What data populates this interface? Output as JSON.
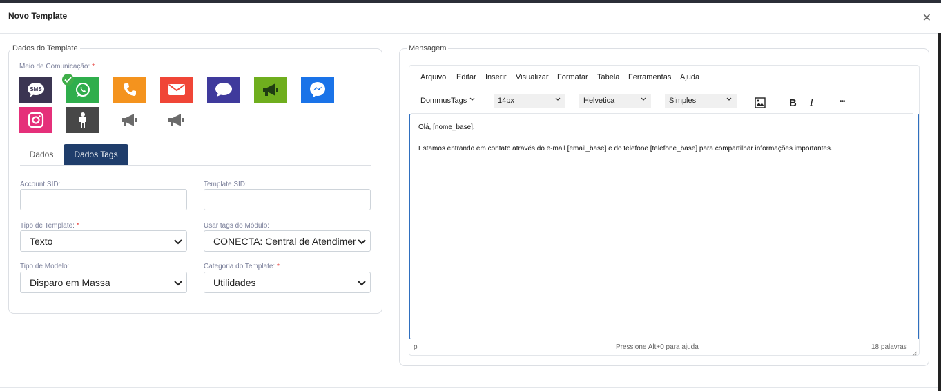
{
  "modal": {
    "title": "Novo Template"
  },
  "dados_template": {
    "legend": "Dados do Template",
    "meio_label": "Meio de Comunicação:",
    "channels": [
      {
        "name": "sms",
        "label": "SMS",
        "color": "#3b3552",
        "selected": false
      },
      {
        "name": "whatsapp",
        "color": "#2fae4c",
        "selected": true
      },
      {
        "name": "phone",
        "color": "#f4931e",
        "selected": false
      },
      {
        "name": "email",
        "color": "#f04637",
        "selected": false
      },
      {
        "name": "chat",
        "color": "#3f3a9c",
        "selected": false
      },
      {
        "name": "megaphone",
        "color": "#6fae1e",
        "selected": false
      },
      {
        "name": "messenger",
        "color": "#1a73e8",
        "selected": false
      },
      {
        "name": "instagram",
        "color": "#e5307a",
        "selected": false
      },
      {
        "name": "person",
        "color": "#474747",
        "selected": false
      },
      {
        "name": "megaphone-gray",
        "color": "#6b6b6b",
        "selected": false
      },
      {
        "name": "megaphone-gray-2",
        "color": "#6b6b6b",
        "selected": false
      }
    ],
    "tabs": {
      "dados": "Dados",
      "dados_tags": "Dados Tags"
    },
    "fields": {
      "account_sid_label": "Account SID:",
      "template_sid_label": "Template SID:",
      "tipo_template_label": "Tipo de Template:",
      "tipo_template_value": "Texto",
      "usar_tags_label": "Usar tags do Módulo:",
      "usar_tags_value": "CONECTA: Central de Atendimento",
      "tipo_modelo_label": "Tipo de Modelo:",
      "tipo_modelo_value": "Disparo em Massa",
      "categoria_label": "Categoria do Template:",
      "categoria_value": "Utilidades"
    }
  },
  "mensagem": {
    "legend": "Mensagem",
    "menubar": [
      "Arquivo",
      "Editar",
      "Inserir",
      "Visualizar",
      "Formatar",
      "Tabela",
      "Ferramentas",
      "Ajuda"
    ],
    "toolbar": {
      "tags": "DommusTags",
      "size": "14px",
      "font": "Helvetica",
      "style": "Simples",
      "bold": "B",
      "italic": "I",
      "more": "•••"
    },
    "content": {
      "line1": "Olá, [nome_base].",
      "line2": "Estamos entrando em contato através do e-mail [email_base] e do telefone [telefone_base] para compartilhar informações importantes."
    },
    "statusbar": {
      "path": "p",
      "help": "Pressione Alt+0 para ajuda",
      "words": "18 palavras"
    }
  }
}
